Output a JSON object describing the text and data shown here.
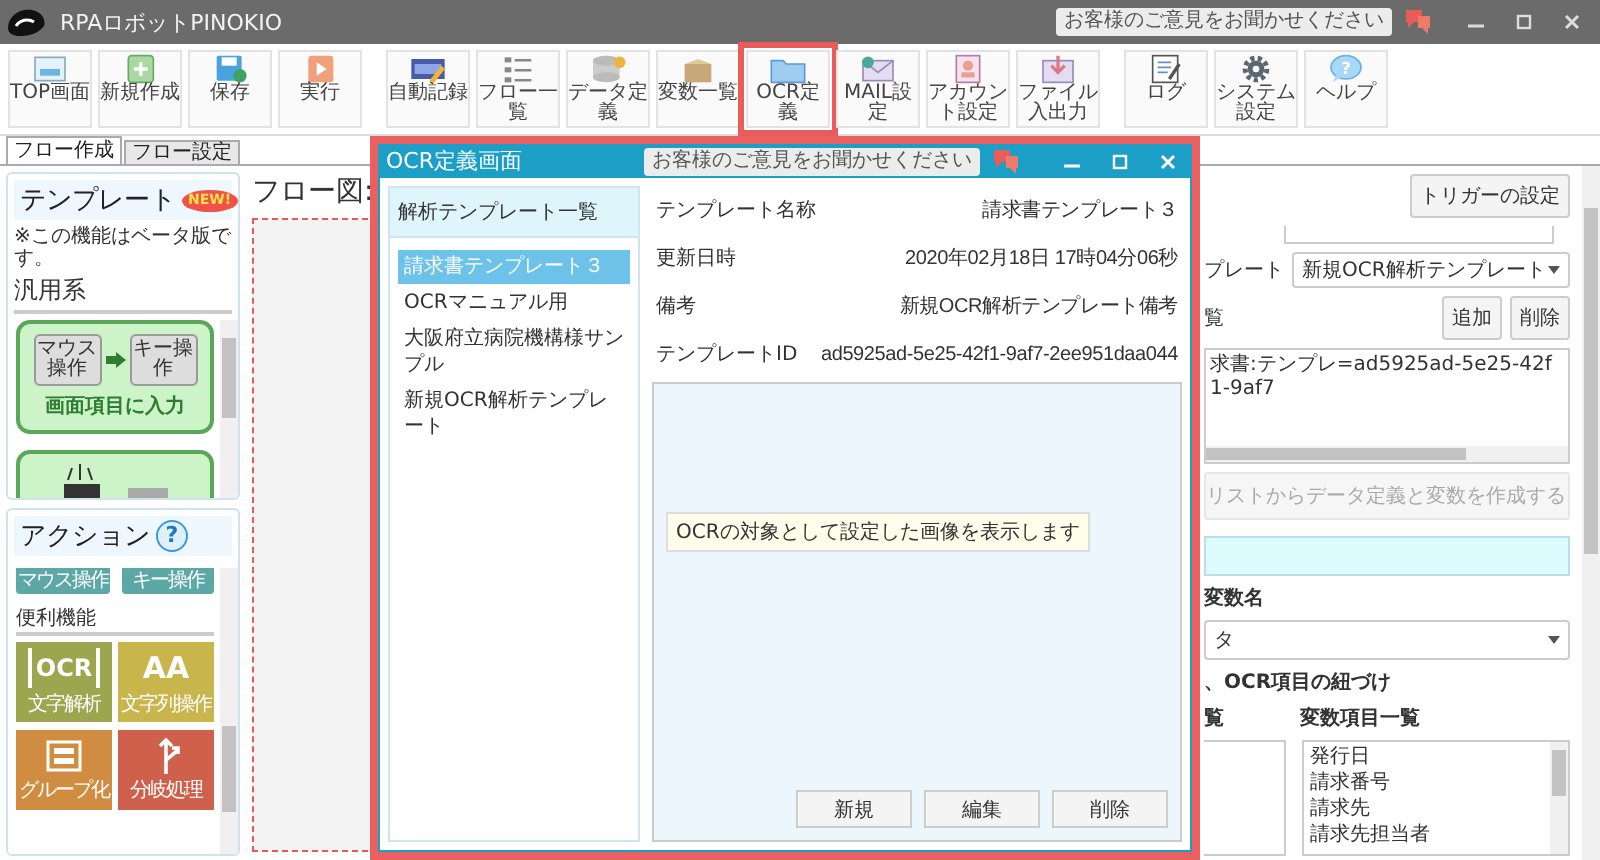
{
  "window": {
    "title": "RPAロボットPINOKIO",
    "feedback": "お客様のご意見をお聞かせください"
  },
  "toolbar": {
    "groups": [
      {
        "items": [
          {
            "label": "TOP画面",
            "highlighted": false
          },
          {
            "label": "新規作成",
            "highlighted": false
          },
          {
            "label": "保存",
            "highlighted": false
          },
          {
            "label": "実行",
            "highlighted": false
          }
        ]
      },
      {
        "items": [
          {
            "label": "自動記録",
            "highlighted": false
          },
          {
            "label": "フロー一覧",
            "highlighted": false
          },
          {
            "label": "データ定義",
            "highlighted": false
          },
          {
            "label": "変数一覧",
            "highlighted": false
          },
          {
            "label": "OCR定義",
            "highlighted": true
          },
          {
            "label": "MAIL設定",
            "highlighted": false
          },
          {
            "label": "アカウント設定",
            "highlighted": false
          },
          {
            "label": "ファイル入出力",
            "highlighted": false
          }
        ]
      },
      {
        "items": [
          {
            "label": "ログ",
            "highlighted": false
          },
          {
            "label": "システム設定",
            "highlighted": false
          },
          {
            "label": "ヘルプ",
            "highlighted": false,
            "glyph": "?"
          }
        ]
      }
    ]
  },
  "tabs": [
    {
      "label": "フロー作成",
      "selected": true
    },
    {
      "label": "フロー設定",
      "selected": false
    }
  ],
  "templates": {
    "title": "テンプレート",
    "badge": "NEW!",
    "note": "※この機能はベータ版です。",
    "category": "汎用系",
    "cards": [
      {
        "from": "マウス操作",
        "to": "キー操作",
        "label": "画面項目に入力"
      }
    ]
  },
  "actions": {
    "title": "アクション",
    "help": "?",
    "top_tiles": [
      {
        "label": "マウス操作"
      },
      {
        "label": "キー操作"
      }
    ],
    "group": "便利機能",
    "tiles": [
      {
        "label": "文字解析",
        "color": "#9ba64e",
        "icon_text": "OCR"
      },
      {
        "label": "文字列操作",
        "color": "#c8b54c",
        "icon_text": "AA"
      },
      {
        "label": "グループ化",
        "color": "#d08c40"
      },
      {
        "label": "分岐処理",
        "color": "#cf604c"
      }
    ]
  },
  "flow": {
    "title": "フロー図:"
  },
  "right_panel": {
    "trigger_button": "トリガーの設定",
    "template_label": "プレート",
    "template_select": "新規OCR解析テンプレート",
    "list_label": "覧",
    "add_button": "追加",
    "delete_button": "削除",
    "list_text": "求書:テンプレ=ad5925ad-5e25-42f1-9af7",
    "create_button": {
      "label": "リストからデータ定義と変数を作成する",
      "disabled": true
    },
    "variable_label": "変数名",
    "variable_select": "タ",
    "mapping_label": "、OCR項目の紐づけ",
    "ocr_items_label": "覧",
    "variable_items_label": "変数項目一覧",
    "variable_items": [
      "発行日",
      "請求番号",
      "請求先",
      "請求先担当者"
    ]
  },
  "dialog": {
    "title": "OCR定義画面",
    "feedback": "お客様のご意見をお聞かせください",
    "list_title": "解析テンプレート一覧",
    "templates": [
      {
        "name": "請求書テンプレート３",
        "selected": true
      },
      {
        "name": "OCRマニュアル用",
        "selected": false
      },
      {
        "name": "大阪府立病院機構様サンプル",
        "selected": false
      },
      {
        "name": "新規OCR解析テンプレート",
        "selected": false
      }
    ],
    "fields": [
      {
        "label": "テンプレート名称",
        "value": "請求書テンプレート３"
      },
      {
        "label": "更新日時",
        "value": "2020年02月18日 17時04分06秒"
      },
      {
        "label": "備考",
        "value": "新規OCR解析テンプレート備考"
      },
      {
        "label": "テンプレートID",
        "value": "ad5925ad-5e25-42f1-9af7-2ee951daa044"
      }
    ],
    "preview_hint": "OCRの対象として設定した画像を表示します",
    "buttons": [
      "新規",
      "編集",
      "削除"
    ]
  }
}
